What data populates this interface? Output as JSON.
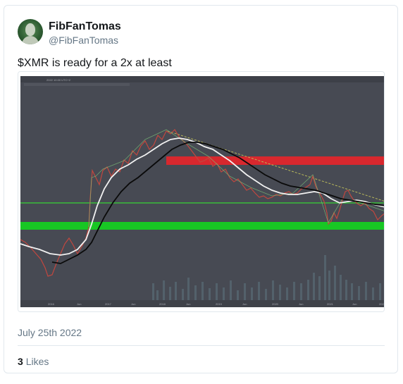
{
  "author": {
    "display_name": "FibFanTomas",
    "handle": "@FibFanTomas",
    "avatar_icon": "profile-avatar"
  },
  "tweet": {
    "text": "$XMR is ready for a 2x at least",
    "timestamp": "July 25th 2022",
    "likes_count": "3",
    "likes_label": "Likes"
  },
  "chart": {
    "header_text": "2022 10:00 UTC+2",
    "x_labels": [
      "2016",
      "Jun",
      "2017",
      "Jun",
      "2018",
      "Jun",
      "2019",
      "Jun",
      "2020",
      "Jun",
      "2021",
      "Jun",
      "2022"
    ],
    "colors": {
      "background": "#474a53",
      "resistance_zone": "#e0262c",
      "support_zone": "#18c724",
      "upper_line": "#35d335",
      "moving_average_short": "#f2f2f2",
      "moving_average_long": "#000000",
      "trendline": "#b9b95a"
    }
  }
}
